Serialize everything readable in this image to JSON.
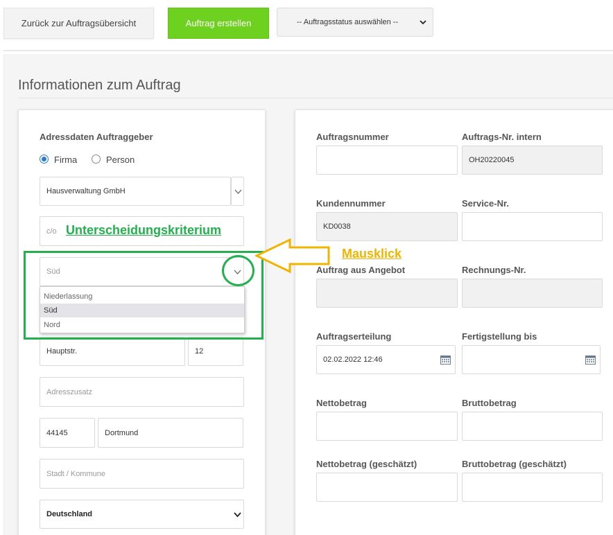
{
  "toolbar": {
    "back_label": "Zurück zur Auftragsübersicht",
    "create_label": "Auftrag erstellen",
    "status_select_value": "-- Auftragsstatus auswählen --"
  },
  "section_title": "Informationen zum Auftrag",
  "left": {
    "heading": "Adressdaten Auftraggeber",
    "radio_firma": "Firma",
    "radio_person": "Person",
    "radio_selected": "Firma",
    "company_value": "Hausverwaltung GmbH",
    "co_placeholder": "c/o",
    "branch_value": "Süd",
    "branch_options": [
      "Niederlassung",
      "Süd",
      "Nord"
    ],
    "branch_selected_option": "Süd",
    "street_value": "Hauptstr.",
    "house_number_value": "12",
    "address_extra_placeholder": "Adresszusatz",
    "zip_value": "44145",
    "city_value": "Dortmund",
    "district_placeholder": "Stadt / Kommune",
    "country_value": "Deutschland"
  },
  "right": {
    "order_number_label": "Auftragsnummer",
    "order_number_value": "",
    "internal_number_label": "Auftrags-Nr. intern",
    "internal_number_value": "OH20220045",
    "customer_number_label": "Kundennummer",
    "customer_number_value": "KD0038",
    "service_number_label": "Service-Nr.",
    "service_number_value": "",
    "from_offer_label": "Auftrag aus Angebot",
    "from_offer_value": "",
    "invoice_number_label": "Rechnungs-Nr.",
    "invoice_number_value": "",
    "order_date_label": "Auftragserteilung",
    "order_date_value": "02.02.2022 12:46",
    "completion_label": "Fertigstellung bis",
    "completion_value": "",
    "net_label": "Nettobetrag",
    "net_value": "",
    "gross_label": "Bruttobetrag",
    "gross_value": "",
    "net_est_label": "Nettobetrag (geschätzt)",
    "net_est_value": "",
    "gross_est_label": "Bruttobetrag (geschätzt)",
    "gross_est_value": ""
  },
  "annotations": {
    "criterion_label": "Unterscheidungskriterium",
    "click_label": "Mausklick",
    "green": "#22b14c",
    "orange": "#f0b400"
  },
  "colors": {
    "accent_green": "#6fd11f",
    "radio_blue": "#2a7bd4"
  }
}
